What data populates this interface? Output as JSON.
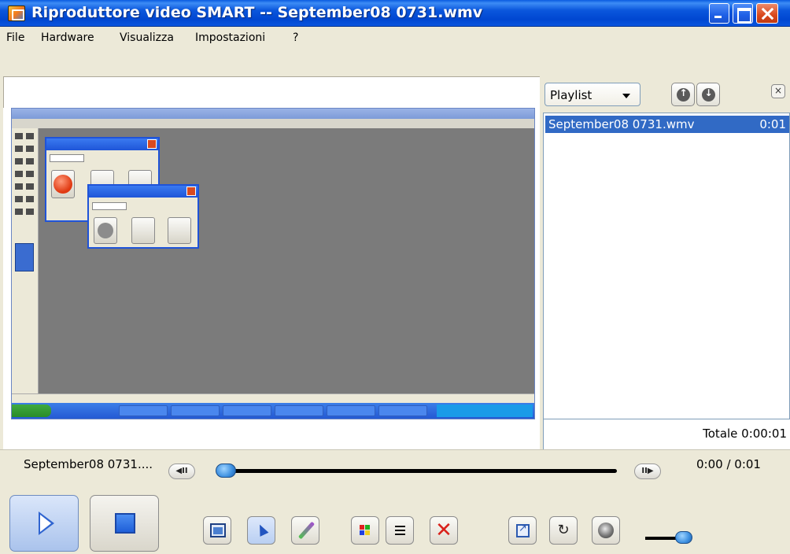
{
  "window": {
    "title": "Riproduttore video SMART -- September08 0731.wmv"
  },
  "menu": {
    "file": "File",
    "hardware": "Hardware",
    "visualizza": "Visualizza",
    "impostazioni": "Impostazioni",
    "help": "?"
  },
  "playlist": {
    "selector_label": "Playlist",
    "items": [
      {
        "name": "September08 0731.wmv",
        "duration": "0:01"
      }
    ],
    "total": "Totale 0:00:01"
  },
  "player": {
    "current_file": "September08 0731....",
    "time": "0:00 / 0:01",
    "progress": 0.0
  },
  "icons": {
    "app": "smart-recorder-icon",
    "play": "play-icon",
    "stop": "stop-icon",
    "step_back": "step-back-icon",
    "step_forward": "step-forward-icon",
    "screen_capture": "screen-capture-icon",
    "select": "pointer-icon",
    "pen": "pen-icon",
    "color": "color-palette-icon",
    "lines": "line-width-icon",
    "delete": "delete-icon",
    "fullscreen": "fullscreen-icon",
    "loop": "loop-icon",
    "volume": "volume-icon"
  },
  "colors": {
    "titlebar": "#0a56dc",
    "selection": "#316ac5",
    "accent": "#3c8fe0"
  }
}
